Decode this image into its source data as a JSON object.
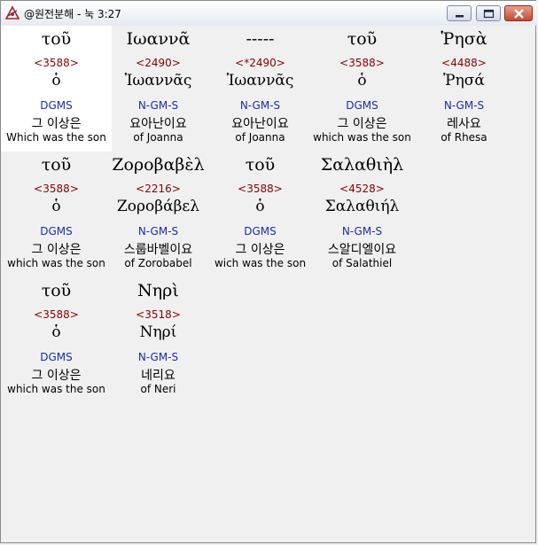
{
  "window": {
    "title": "@원전분해 - 눅 3:27"
  },
  "rows": [
    [
      {
        "greek": "τοῦ",
        "strong": "<3588>",
        "lexeme": "ὁ",
        "morph": "DGMS",
        "korean": "그 이상은",
        "english": "Which was the son",
        "selected": true
      },
      {
        "greek": "Ιωαννᾶ",
        "strong": "<2490>",
        "lexeme": "Ἰωαννᾶς",
        "morph": "N-GM-S",
        "korean": "요아난이요",
        "english": "of Joanna"
      },
      {
        "greek": "-----",
        "strong": "<*2490>",
        "lexeme": "Ἰωαννᾶς",
        "morph": "N-GM-S",
        "korean": "요아난이요",
        "english": "of Joanna"
      },
      {
        "greek": "τοῦ",
        "strong": "<3588>",
        "lexeme": "ὁ",
        "morph": "DGMS",
        "korean": "그 이상은",
        "english": "which was the son"
      },
      {
        "greek": "Ῥησὰ",
        "strong": "<4488>",
        "lexeme": "Ῥησά",
        "morph": "N-GM-S",
        "korean": "레사요",
        "english": "of Rhesa"
      }
    ],
    [
      {
        "greek": "τοῦ",
        "strong": "<3588>",
        "lexeme": "ὁ",
        "morph": "DGMS",
        "korean": "그 이상은",
        "english": "which was the son"
      },
      {
        "greek": "Ζοροβαβὲλ",
        "strong": "<2216>",
        "lexeme": "Ζοροβάβελ",
        "morph": "N-GM-S",
        "korean": "스룹바벨이요",
        "english": "of Zorobabel"
      },
      {
        "greek": "τοῦ",
        "strong": "<3588>",
        "lexeme": "ὁ",
        "morph": "DGMS",
        "korean": "그 이상은",
        "english": "wich was the son"
      },
      {
        "greek": "Σαλαθιὴλ",
        "strong": "<4528>",
        "lexeme": "Σαλαθιήλ",
        "morph": "N-GM-S",
        "korean": "스알디엘이요",
        "english": "of Salathiel"
      }
    ],
    [
      {
        "greek": "τοῦ",
        "strong": "<3588>",
        "lexeme": "ὁ",
        "morph": "DGMS",
        "korean": "그 이상은",
        "english": "which was the son"
      },
      {
        "greek": "Νηρὶ",
        "strong": "<3518>",
        "lexeme": "Νηρί",
        "morph": "N-GM-S",
        "korean": "네리요",
        "english": "of Neri"
      }
    ]
  ],
  "colors": {
    "strong": "#8b0000",
    "morph": "#1a2ea8",
    "selected_bg": "#ffffff",
    "background": "#f0f0f0"
  }
}
